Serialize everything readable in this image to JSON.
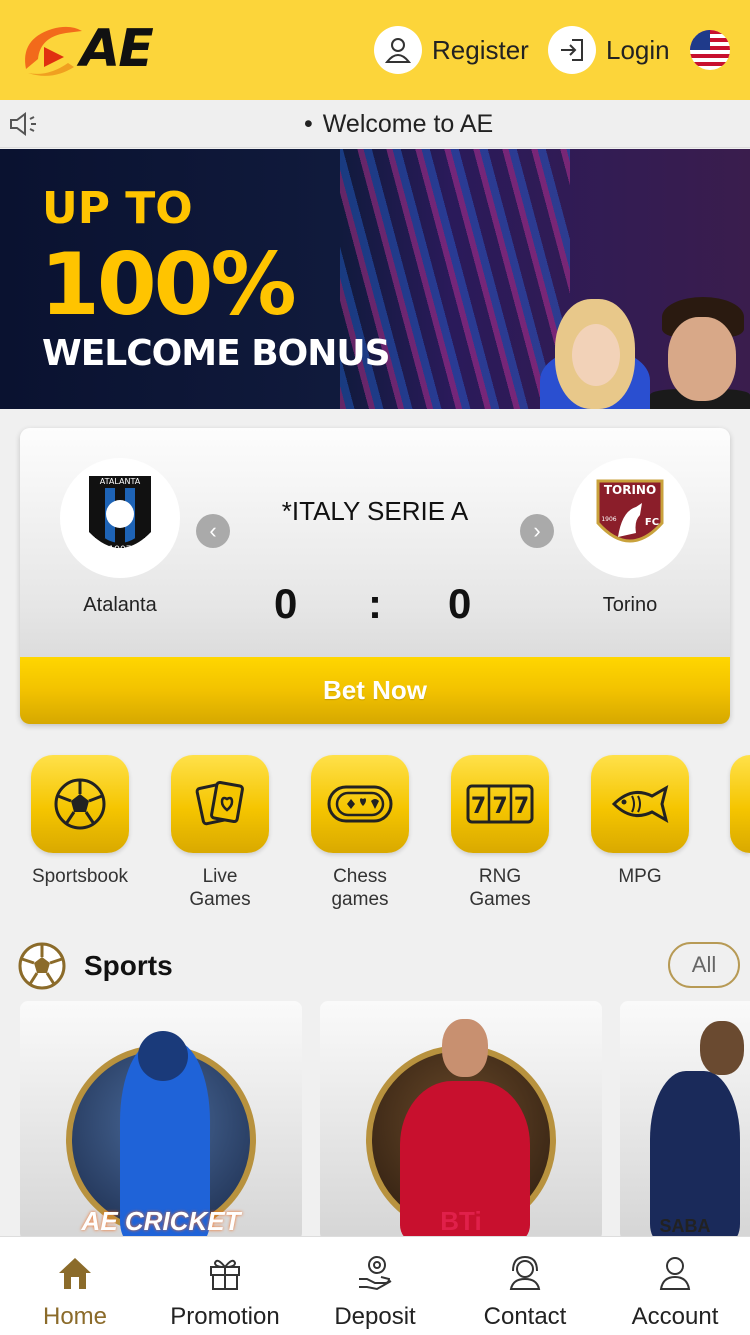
{
  "header": {
    "logo_text": "AE",
    "register_label": "Register",
    "login_label": "Login"
  },
  "marquee": {
    "text": "Welcome to AE"
  },
  "banner": {
    "line1": "UP TO",
    "line2": "100%",
    "line3": "WELCOME BONUS"
  },
  "match": {
    "league": "*ITALY SERIE A",
    "home_team": "Atalanta",
    "away_team": "Torino",
    "home_score": "0",
    "separator": ":",
    "away_score": "0",
    "bet_label": "Bet Now",
    "home_logo_text": "ATALANTA",
    "home_logo_year": "1907",
    "away_logo_text": "TORINO",
    "away_logo_fc": "FC",
    "away_logo_year": "1906"
  },
  "categories": [
    {
      "label": "Sportsbook",
      "icon": "soccer-ball-icon"
    },
    {
      "label": "Live\nGames",
      "icon": "cards-icon"
    },
    {
      "label": "Chess\ngames",
      "icon": "chess-table-icon"
    },
    {
      "label": "RNG\nGames",
      "icon": "slot-777-icon"
    },
    {
      "label": "MPG",
      "icon": "fish-icon"
    }
  ],
  "sports": {
    "title": "Sports",
    "all_label": "All",
    "cards": [
      {
        "label": "AE CRICKET"
      },
      {
        "label": "BTi"
      },
      {
        "label": "SABA"
      }
    ]
  },
  "bottom_nav": [
    {
      "label": "Home",
      "icon": "home-icon",
      "active": true
    },
    {
      "label": "Promotion",
      "icon": "gift-icon"
    },
    {
      "label": "Deposit",
      "icon": "deposit-icon"
    },
    {
      "label": "Contact",
      "icon": "headset-icon"
    },
    {
      "label": "Account",
      "icon": "user-icon"
    }
  ],
  "colors": {
    "brand_yellow": "#fcd53a",
    "button_gold": "#f2c200",
    "active_nav": "#8b6b2a",
    "logo_orange": "#f26a1b"
  }
}
